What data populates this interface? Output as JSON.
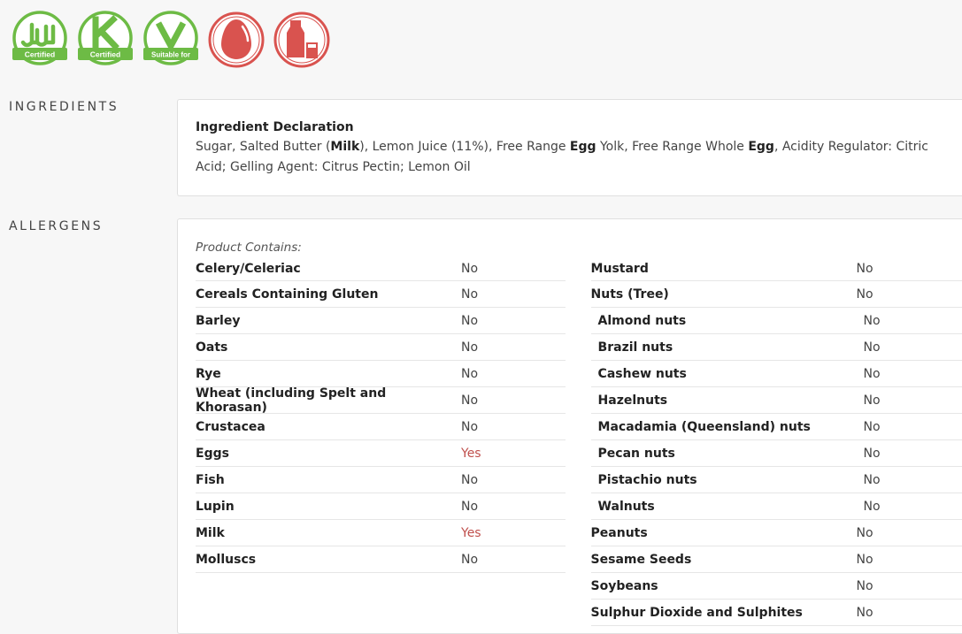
{
  "badges": [
    {
      "name": "halal",
      "caption": "Certified",
      "color": "#6dbb45"
    },
    {
      "name": "kosher",
      "caption": "Certified",
      "color": "#6dbb45"
    },
    {
      "name": "vegetarian",
      "caption": "Suitable for",
      "color": "#6dbb45"
    },
    {
      "name": "egg",
      "caption": "",
      "color": "#d9534f"
    },
    {
      "name": "milk",
      "caption": "",
      "color": "#d9534f"
    }
  ],
  "sections": {
    "ingredients": "INGREDIENTS",
    "allergens": "ALLERGENS"
  },
  "ingredients": {
    "title": "Ingredient Declaration",
    "parts": [
      {
        "text": "Sugar, Salted Butter (",
        "bold": false
      },
      {
        "text": "Milk",
        "bold": true
      },
      {
        "text": "), Lemon Juice (11%), Free Range ",
        "bold": false
      },
      {
        "text": "Egg",
        "bold": true
      },
      {
        "text": " Yolk, Free Range Whole ",
        "bold": false
      },
      {
        "text": "Egg",
        "bold": true
      },
      {
        "text": ", Acidity Regulator: Citric Acid; Gelling Agent: Citrus Pectin; Lemon Oil",
        "bold": false
      }
    ]
  },
  "allergens": {
    "contains_label": "Product Contains:",
    "left": [
      {
        "name": "Celery/Celeriac",
        "value": "No"
      },
      {
        "name": "Cereals Containing Gluten",
        "value": "No"
      },
      {
        "name": "Barley",
        "value": "No"
      },
      {
        "name": "Oats",
        "value": "No"
      },
      {
        "name": "Rye",
        "value": "No"
      },
      {
        "name": "Wheat (including Spelt and Khorasan)",
        "value": "No"
      },
      {
        "name": "Crustacea",
        "value": "No"
      },
      {
        "name": "Eggs",
        "value": "Yes"
      },
      {
        "name": "Fish",
        "value": "No"
      },
      {
        "name": "Lupin",
        "value": "No"
      },
      {
        "name": "Milk",
        "value": "Yes"
      },
      {
        "name": "Molluscs",
        "value": "No"
      }
    ],
    "right": [
      {
        "name": "Mustard",
        "value": "No",
        "sub": false
      },
      {
        "name": "Nuts (Tree)",
        "value": "No",
        "sub": false
      },
      {
        "name": "Almond nuts",
        "value": "No",
        "sub": true
      },
      {
        "name": "Brazil nuts",
        "value": "No",
        "sub": true
      },
      {
        "name": "Cashew nuts",
        "value": "No",
        "sub": true
      },
      {
        "name": "Hazelnuts",
        "value": "No",
        "sub": true
      },
      {
        "name": "Macadamia (Queensland) nuts",
        "value": "No",
        "sub": true
      },
      {
        "name": "Pecan nuts",
        "value": "No",
        "sub": true
      },
      {
        "name": "Pistachio nuts",
        "value": "No",
        "sub": true
      },
      {
        "name": "Walnuts",
        "value": "No",
        "sub": true
      },
      {
        "name": "Peanuts",
        "value": "No",
        "sub": false
      },
      {
        "name": "Sesame Seeds",
        "value": "No",
        "sub": false
      },
      {
        "name": "Soybeans",
        "value": "No",
        "sub": false
      },
      {
        "name": "Sulphur Dioxide and Sulphites",
        "value": "No",
        "sub": false
      }
    ]
  }
}
